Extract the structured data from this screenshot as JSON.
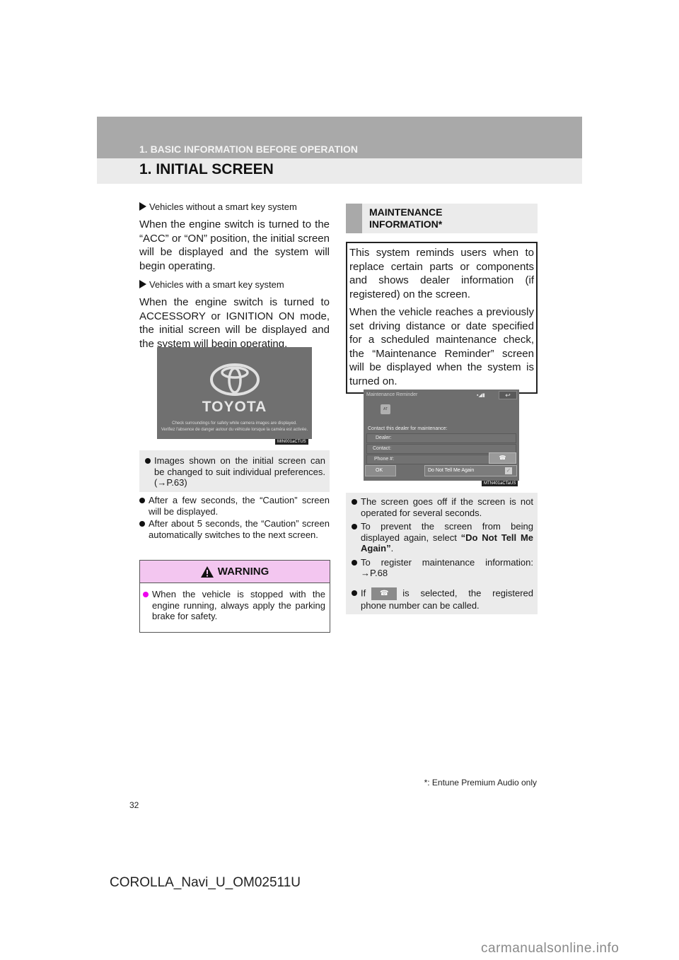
{
  "header": {
    "section": "1. BASIC INFORMATION BEFORE OPERATION",
    "title": "1. INITIAL SCREEN"
  },
  "left_column": {
    "subhead_1": "Vehicles without a smart key system",
    "para_1": "When the engine switch is turned to the “ACC” or “ON” position, the initial screen will be displayed and the system will begin operating.",
    "subhead_2": "Vehicles with a smart key system",
    "para_2": "When the engine switch is turned to ACCESSORY or IGNITION ON mode, the initial screen will be displayed and the system will begin operating.",
    "initial_screen": {
      "brand": "TOYOTA",
      "caption_en": "Check surroundings for safety while camera images are displayed.",
      "caption_fr": "Verifiez l'absence de danger autour du véhicule lorsque la caméra est activée.",
      "image_code": "MIN001aCTUS"
    },
    "note": "Images shown on the initial screen can be changed to suit individual preferences. (→P.63)",
    "bullets": [
      "After a few seconds, the “Caution” screen will be displayed.",
      "After about 5 seconds, the “Caution” screen automatically switches to the next screen."
    ],
    "warning": {
      "title": "WARNING",
      "text": "When the vehicle is stopped with the engine running, always apply the parking brake for safety."
    }
  },
  "right_column": {
    "heading_line1": "MAINTENANCE",
    "heading_line2": "INFORMATION*",
    "para_1": "This system reminds users when to replace certain parts or components and shows dealer information (if registered) on the screen.",
    "para_2": "When the vehicle reaches a previously set driving distance or date specified for a scheduled maintenance check, the “Maintenance Reminder” screen will be displayed when the system is turned on.",
    "reminder_screen": {
      "title": "Maintenance Reminder",
      "back_icon": "↩",
      "flag_label": "AT",
      "contact_prompt": "Contact this dealer for maintenance:",
      "dealer_label": "Dealer:",
      "contact_label": "Contact:",
      "phone_label": "Phone #:",
      "ok_label": "OK",
      "dont_tell_label": "Do Not Tell Me Again",
      "image_code": "MTN401aCTaUS"
    },
    "bullets": {
      "b1": "The screen goes off if the screen is not operated for several seconds.",
      "b2_prefix": "To prevent the screen from being displayed again, select ",
      "b2_bold": "“Do Not Tell Me Again”",
      "b2_suffix": ".",
      "b3": "To register maintenance information: →P.68",
      "b4_prefix": "If",
      "b4_suffix": "is selected, the registered phone number can be called."
    }
  },
  "footer": {
    "footnote": "*: Entune Premium Audio only",
    "page_number": "32",
    "doc_code": "COROLLA_Navi_U_OM02511U",
    "watermark": "carmanualsonline.info"
  }
}
